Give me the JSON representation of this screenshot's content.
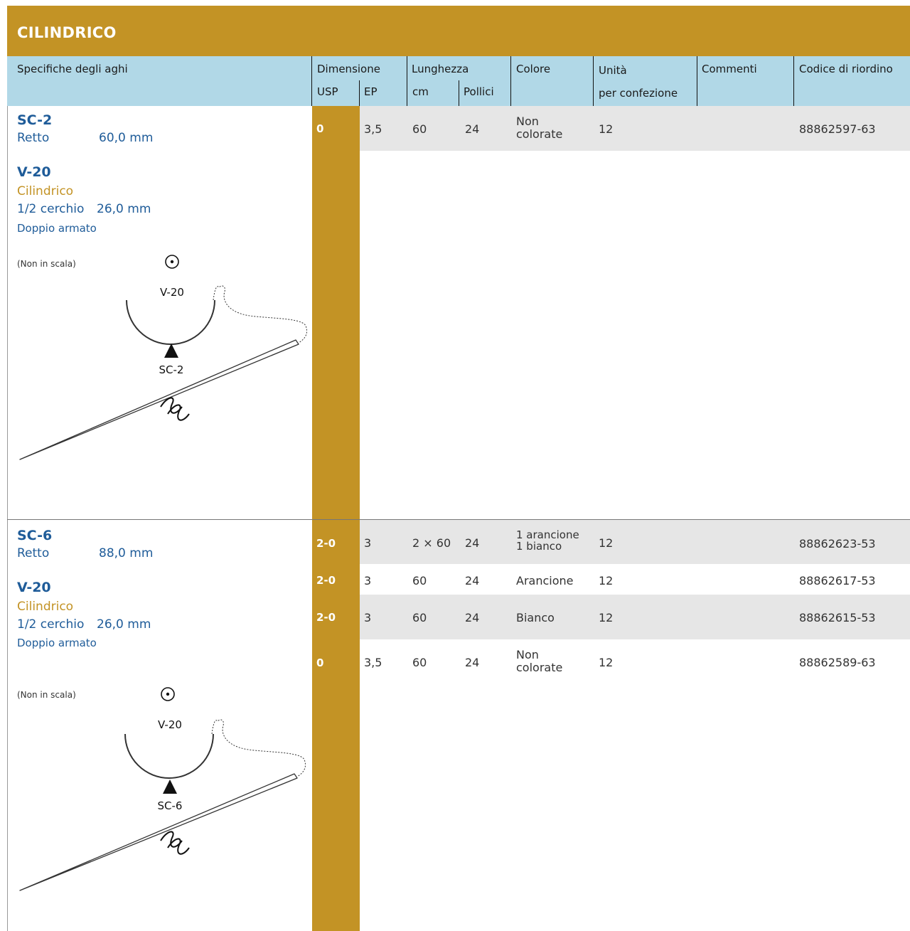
{
  "title": "CILINDRICO",
  "header": {
    "specs": "Specifiche degli aghi",
    "dimensione": "Dimensione",
    "usp": "USP",
    "ep": "EP",
    "lunghezza": "Lunghezza",
    "cm": "cm",
    "pollici": "Pollici",
    "colore": "Colore",
    "unita": "Unità",
    "per_confezione": "per confezione",
    "commenti": "Commenti",
    "codice": "Codice di riordino"
  },
  "sections": [
    {
      "needle1_name": "SC-2",
      "needle1_shape": "Retto",
      "needle1_length": "60,0 mm",
      "needle2_name": "V-20",
      "needle2_point": "Cilindrico",
      "needle2_shape": "1/2 cerchio",
      "needle2_length": "26,0 mm",
      "armed": "Doppio armato",
      "scale_note": "(Non in scala)",
      "drawing_label_top": "V-20",
      "drawing_label_bottom": "SC-2",
      "rows": [
        {
          "usp": "0",
          "ep": "3,5",
          "cm": "60",
          "pollici": "24",
          "colore_1": "Non",
          "colore_2": "colorate",
          "unita": "12",
          "commenti": "",
          "codice": "88862597-63"
        }
      ]
    },
    {
      "needle1_name": "SC-6",
      "needle1_shape": "Retto",
      "needle1_length": "88,0 mm",
      "needle2_name": "V-20",
      "needle2_point": "Cilindrico",
      "needle2_shape": "1/2 cerchio",
      "needle2_length": "26,0 mm",
      "armed": "Doppio armato",
      "scale_note": "(Non in scala)",
      "drawing_label_top": "V-20",
      "drawing_label_bottom": "SC-6",
      "rows": [
        {
          "usp": "2-0",
          "ep": "3",
          "cm": "2 × 60",
          "pollici": "24",
          "colore_1": "1 arancione",
          "colore_2": "1 bianco",
          "unita": "12",
          "commenti": "",
          "codice": "88862623-53"
        },
        {
          "usp": "2-0",
          "ep": "3",
          "cm": "60",
          "pollici": "24",
          "colore": "Arancione",
          "unita": "12",
          "commenti": "",
          "codice": "88862617-53"
        },
        {
          "usp": "2-0",
          "ep": "3",
          "cm": "60",
          "pollici": "24",
          "colore": "Bianco",
          "unita": "12",
          "commenti": "",
          "codice": "88862615-53"
        },
        {
          "usp": "0",
          "ep": "3,5",
          "cm": "60",
          "pollici": "24",
          "colore_1": "Non",
          "colore_2": "colorate",
          "unita": "12",
          "commenti": "",
          "codice": "88862589-63"
        }
      ]
    }
  ],
  "colors": {
    "gold": "#C39325",
    "header_blue": "#B1D8E7",
    "row_shade": "#E6E6E6",
    "needle_blue": "#1F5C99"
  }
}
